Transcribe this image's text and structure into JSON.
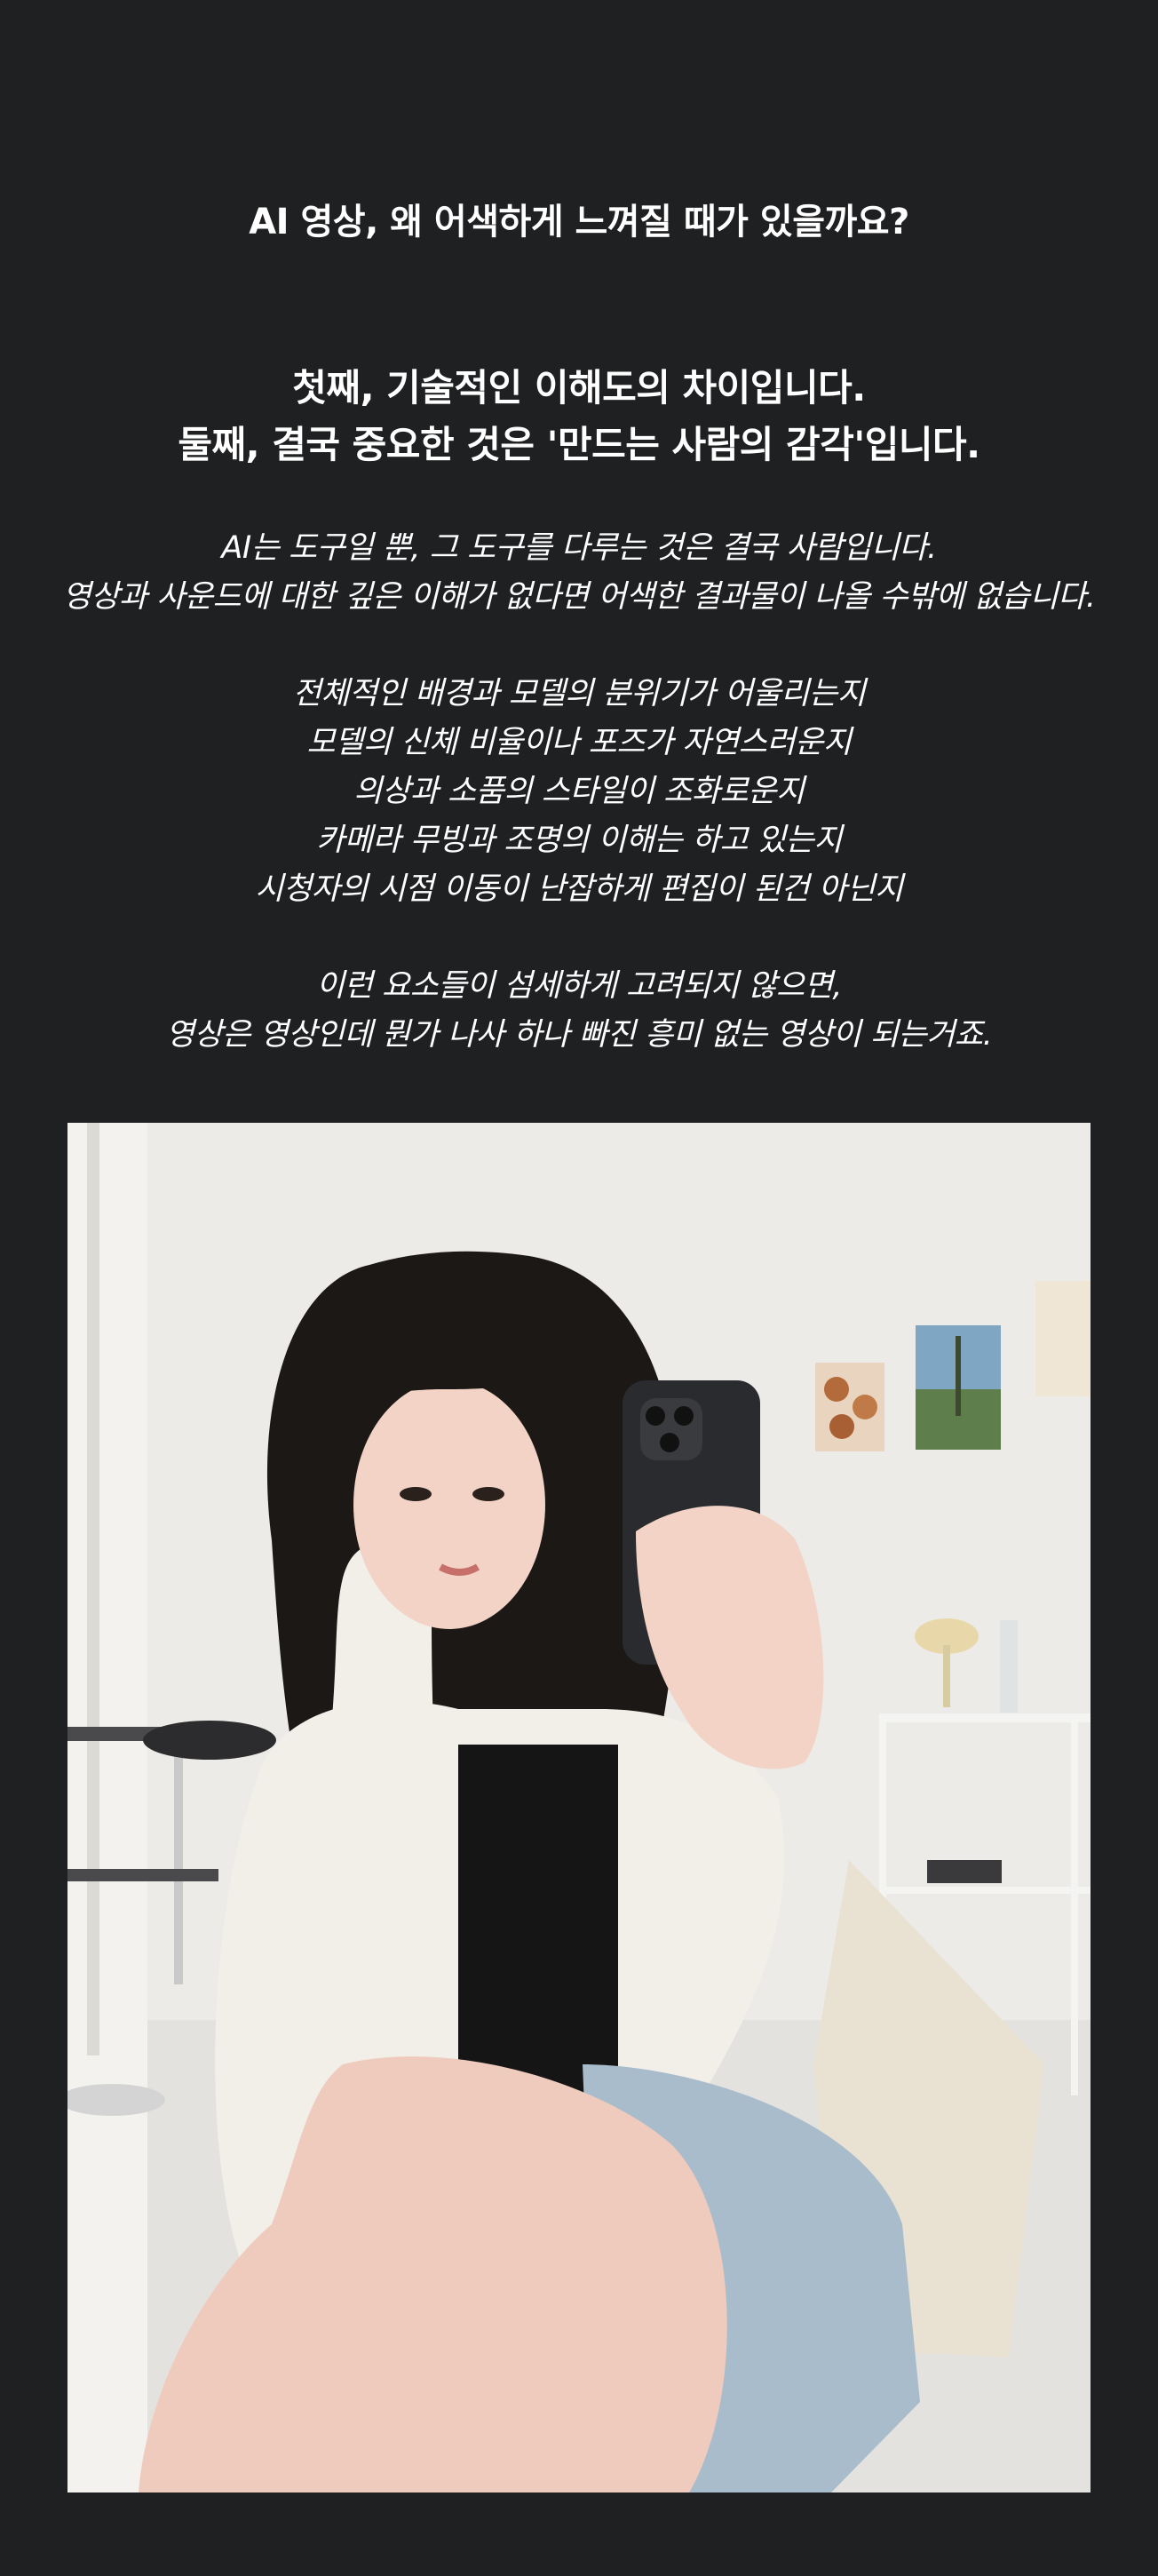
{
  "headline": "AI 영상, 왜 어색하게 느껴질 때가 있을까요?",
  "subheads": [
    "첫째, 기술적인 이해도의 차이입니다.",
    "둘째, 결국 중요한 것은 '만드는 사람의 감각'입니다."
  ],
  "paragraph_1": [
    "AI는 도구일 뿐, 그 도구를 다루는 것은 결국 사람입니다.",
    "영상과 사운드에 대한 깊은 이해가 없다면 어색한 결과물이 나올 수밖에 없습니다."
  ],
  "paragraph_2": [
    "전체적인 배경과 모델의 분위기가 어울리는지",
    "모델의 신체 비율이나 포즈가 자연스러운지",
    "의상과 소품의 스타일이 조화로운지",
    "카메라 무빙과 조명의 이해는 하고 있는지",
    "시청자의 시점 이동이 난잡하게 편집이 된건 아닌지"
  ],
  "paragraph_3": [
    "이런 요소들이 섬세하게 고려되지 않으면,",
    "영상은 영상인데 뭔가 나사 하나 빠진 흥미 없는 영상이 되는거죠."
  ],
  "photo": {
    "icon": "mirror-selfie-photo",
    "colors": {
      "background": "#1f2022",
      "wall": "#ecebe8",
      "hair": "#1c1816",
      "cardigan": "#f2efe9",
      "phone": "#2a2b2e",
      "denim": "#a9bccb",
      "tote": "#e9e1d2",
      "skin": "#efcbbd"
    }
  }
}
